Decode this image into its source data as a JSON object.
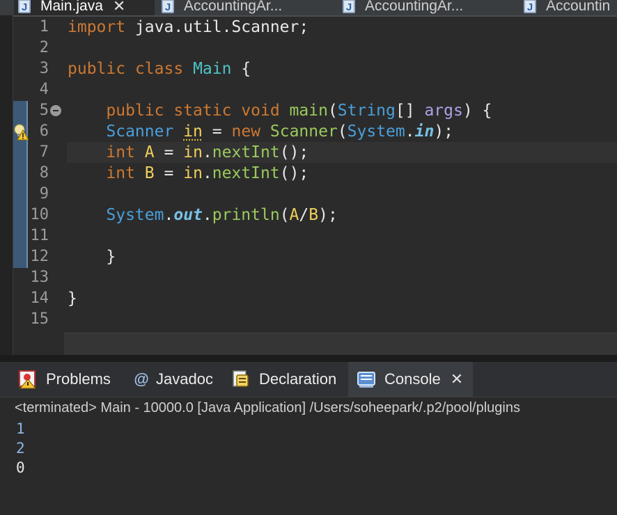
{
  "editor_tabs": [
    {
      "label": "Main.java",
      "icon": "java-file-icon",
      "active": true,
      "closable": true
    },
    {
      "label": "AccountingAr...",
      "icon": "java-file-icon",
      "active": false
    },
    {
      "label": "AccountingAr...",
      "icon": "java-file-icon",
      "active": false
    },
    {
      "label": "Accountin",
      "icon": "java-file-icon",
      "active": false
    }
  ],
  "editor": {
    "line_numbers": [
      "1",
      "2",
      "3",
      "4",
      "5",
      "6",
      "7",
      "8",
      "9",
      "10",
      "11",
      "12",
      "13",
      "14",
      "15"
    ],
    "current_line": 7,
    "lines": [
      "import java.util.Scanner;",
      "",
      "public class Main {",
      "",
      "    public static void main(String[] args) {",
      "    Scanner in = new Scanner(System.in);",
      "    int A = in.nextInt();",
      "    int B = in.nextInt();",
      "",
      "    System.out.println(A/B);",
      "",
      "    }",
      "",
      "}",
      ""
    ]
  },
  "panel": {
    "tabs": [
      {
        "label": "Problems",
        "icon": "problems-icon"
      },
      {
        "label": "Javadoc",
        "icon": "at-sign-icon"
      },
      {
        "label": "Declaration",
        "icon": "declaration-icon"
      },
      {
        "label": "Console",
        "icon": "console-icon",
        "active": true,
        "closable": true
      }
    ],
    "close_glyph": "✕",
    "status": "<terminated> Main - 10000.0 [Java Application] /Users/soheepark/.p2/pool/plugins",
    "output": [
      "1",
      "2",
      "0"
    ]
  },
  "colors": {
    "keyword": "#cc7832",
    "type": "#4a9fda",
    "class": "#4ec2c6",
    "method": "#9bca5e",
    "variable": "#f0d05c",
    "background": "#2b2b2b"
  }
}
